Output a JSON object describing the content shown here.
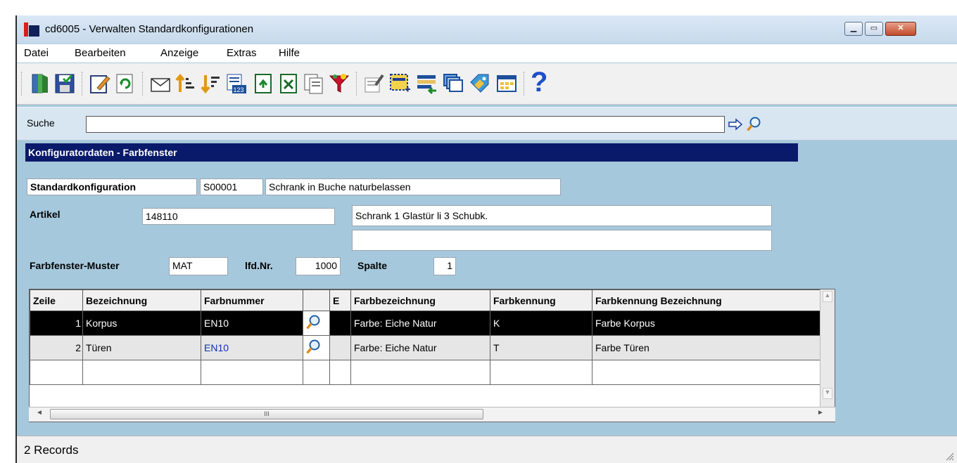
{
  "window": {
    "title": "cd6005 - Verwalten Standardkonfigurationen",
    "close_glyph": "✕",
    "maximize_glyph": "▭",
    "minimize_glyph": "▁"
  },
  "menu": [
    "Datei",
    "Bearbeiten",
    "Anzeige",
    "Extras",
    "Hilfe"
  ],
  "toolbar": {
    "icons": [
      "exit-icon",
      "save-icon",
      "edit-icon",
      "refresh-icon",
      "mail-icon",
      "sort-ascending-icon",
      "sort-descending-icon",
      "number-format-icon",
      "export-icon",
      "excel-export-icon",
      "export-doc-icon",
      "copy-icon",
      "filter-icon",
      "properties-icon",
      "new-record-icon",
      "list-add-icon",
      "windows-icon",
      "tag-icon",
      "layout-icon",
      "help-icon"
    ],
    "help_glyph": "?"
  },
  "search": {
    "label": "Suche",
    "value": ""
  },
  "section": {
    "title": "Konfiguratordaten - Farbfenster"
  },
  "form": {
    "standardkonfiguration_label": "Standardkonfiguration",
    "standardkonfiguration_code": "S00001",
    "standardkonfiguration_desc": "Schrank in Buche naturbelassen",
    "artikel_label": "Artikel",
    "artikel_value": "148110",
    "artikel_desc1": "Schrank 1 Glastür li 3 Schubk.",
    "artikel_desc2": "",
    "muster_label": "Farbfenster-Muster",
    "muster_value": "MAT",
    "lfdnr_label": "lfd.Nr.",
    "lfdnr_value": "1000",
    "spalte_label": "Spalte",
    "spalte_value": "1"
  },
  "table": {
    "headers": [
      "Zeile",
      "Bezeichnung",
      "Farbnummer",
      "",
      "E",
      "Farbbezeichnung",
      "Farbkennung",
      "Farbkennung Bezeichnung"
    ],
    "rows": [
      {
        "zeile": "1",
        "bezeichnung": "Korpus",
        "farbnummer": "EN10",
        "e": "",
        "farbbezeichnung": "Farbe: Eiche Natur",
        "farbkennung": "K",
        "farbkennung_bez": "Farbe Korpus"
      },
      {
        "zeile": "2",
        "bezeichnung": "Türen",
        "farbnummer": "EN10",
        "e": "",
        "farbbezeichnung": "Farbe: Eiche Natur",
        "farbkennung": "T",
        "farbkennung_bez": "Farbe Türen"
      }
    ],
    "selected_row": 1,
    "hscroll_thumb_glyph": "III",
    "scroll_left_glyph": "◄",
    "scroll_right_glyph": "►",
    "scroll_up_glyph": "▲",
    "scroll_down_glyph": "▼"
  },
  "status": {
    "text": "2 Records"
  },
  "colors": {
    "window_bg": "#a6c8dc",
    "section_header": "#0a1a6a",
    "selected_row": "#000000",
    "link_blue": "#1030b0"
  }
}
